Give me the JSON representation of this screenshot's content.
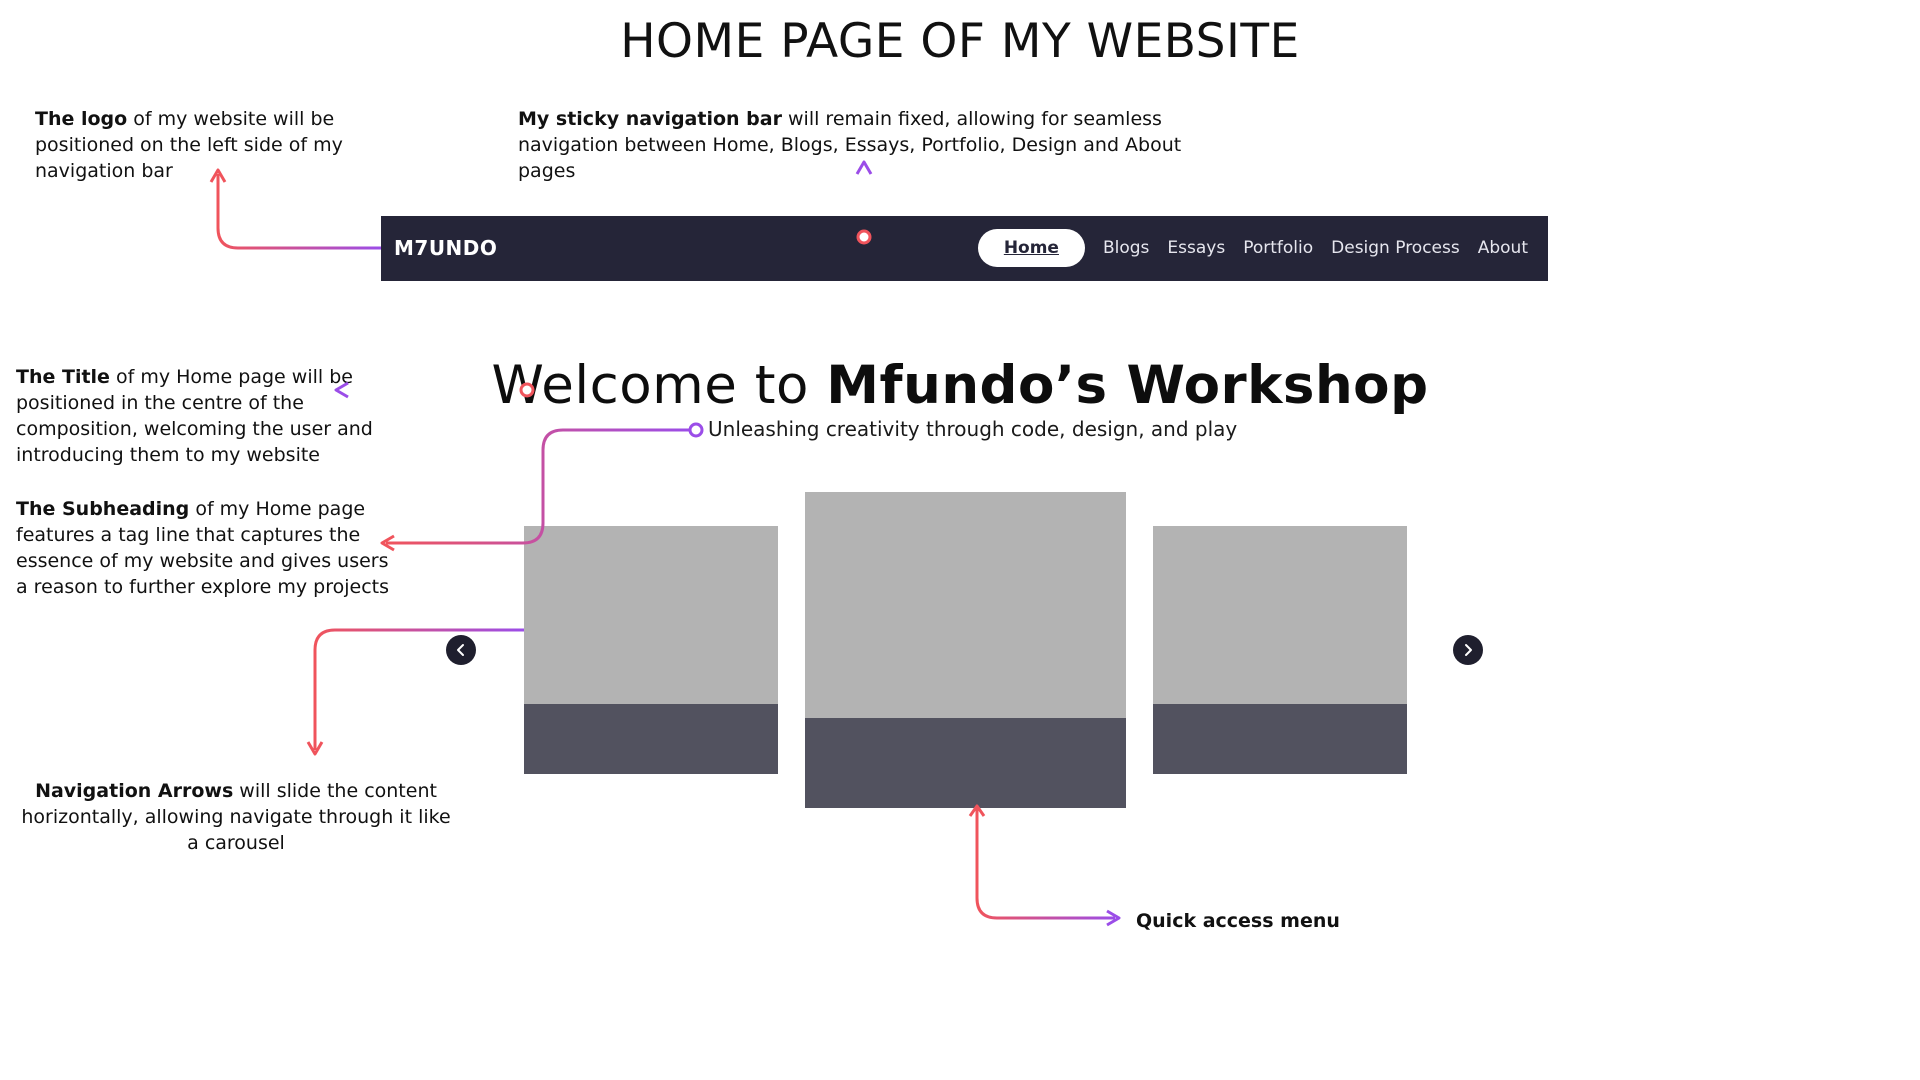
{
  "page_title": "HOME PAGE OF MY WEBSITE",
  "notes": {
    "logo": {
      "bold": "The logo",
      "text": " of my website will be positioned on the left side of my navigation bar"
    },
    "navbar": {
      "bold": "My sticky navigation bar",
      "text": " will remain fixed, allowing for seamless navigation between Home, Blogs, Essays, Portfolio, Design and About pages"
    },
    "title": {
      "bold": "The Title",
      "text": " of my Home page  will be positioned in the centre of the composition, welcoming the user and introducing them to my website"
    },
    "subheading": {
      "bold": "The Subheading",
      "text": " of my Home page features a tag line that captures the essence of  my website and gives users a reason to further explore my projects"
    },
    "arrows": {
      "bold": "Navigation Arrows",
      "text": " will slide the content horizontally, allowing navigate through it like a carousel"
    },
    "quick_access": "Quick access menu"
  },
  "navbar": {
    "brand": "M7UNDO",
    "links": [
      "Home",
      "Blogs",
      "Essays",
      "Portfolio",
      "Design Process",
      "About"
    ],
    "active": "Home"
  },
  "hero": {
    "title_light": "Welcome to ",
    "title_bold": "Mfundo’s Workshop",
    "subtitle": "Unleashing creativity through code, design, and play"
  },
  "carousel": {
    "prev_icon": "chevron-left-icon",
    "next_icon": "chevron-right-icon",
    "cards": 3
  },
  "colors": {
    "navbar_bg": "#252538",
    "card_image": "#b3b3b3",
    "card_footer": "#52525f",
    "connector_red": "#f0545c",
    "connector_purple": "#9b4de8"
  }
}
